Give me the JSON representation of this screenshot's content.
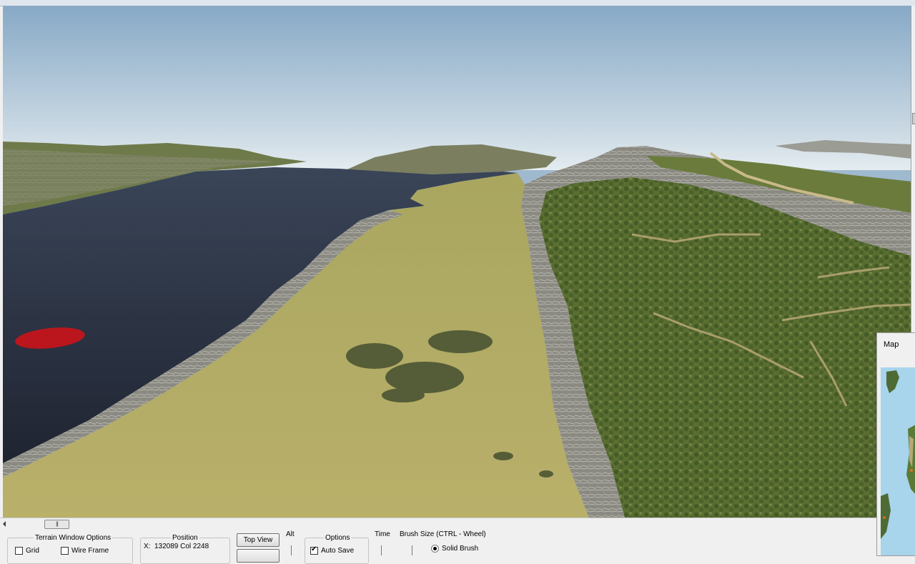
{
  "terrain_options": {
    "title": "Terrain Window Options",
    "grid_label": "Grid",
    "grid_checked": false,
    "wireframe_label": "Wire Frame",
    "wireframe_checked": false
  },
  "position": {
    "title": "Position",
    "x_label": "X:",
    "value": "132089 Col 2248"
  },
  "view_buttons": {
    "top_view": "Top View"
  },
  "alt": {
    "title": "Alt"
  },
  "options": {
    "title": "Options",
    "auto_save_label": "Auto Save",
    "auto_save_checked": true
  },
  "time": {
    "title": "Time"
  },
  "brush": {
    "title": "Brush Size (CTRL - Wheel)",
    "solid_brush_label": "Solid Brush",
    "solid_brush_selected": true
  },
  "map": {
    "title": "Map"
  },
  "scroll": {
    "thumb_glyph": "|||"
  },
  "colors": {
    "sky_top": "#8aacc9",
    "sky_horizon": "#dce6ec",
    "water": "#2a3140",
    "grass": "#b4ae5a",
    "forest": "#5d7034",
    "rock": "#8f8f88",
    "brush_marker": "#c8141a"
  }
}
